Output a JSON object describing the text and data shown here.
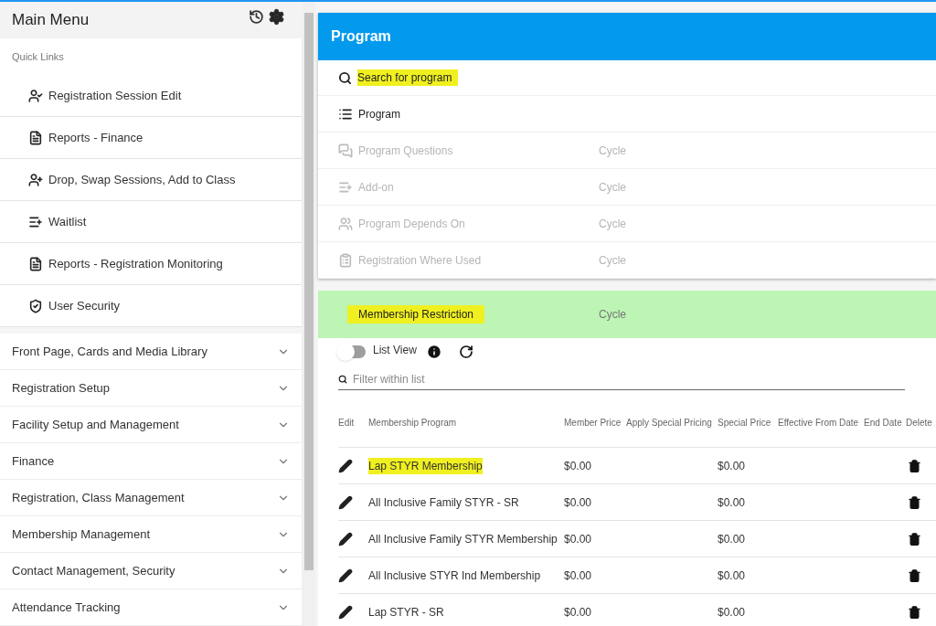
{
  "sidebar": {
    "title": "Main Menu",
    "quick_links_label": "Quick Links",
    "quick_links": [
      {
        "label": "Registration Session Edit"
      },
      {
        "label": "Reports - Finance"
      },
      {
        "label": "Drop, Swap Sessions, Add to Class"
      },
      {
        "label": "Waitlist"
      },
      {
        "label": "Reports - Registration Monitoring"
      },
      {
        "label": "User Security"
      }
    ],
    "sections": [
      {
        "label": "Front Page, Cards and Media Library",
        "expanded": false
      },
      {
        "label": "Registration Setup",
        "expanded": false
      },
      {
        "label": "Facility Setup and Management",
        "expanded": false
      },
      {
        "label": "Finance",
        "expanded": false
      },
      {
        "label": "Registration, Class Management",
        "expanded": false
      },
      {
        "label": "Membership Management",
        "expanded": false
      },
      {
        "label": "Contact Management, Security",
        "expanded": false
      },
      {
        "label": "Attendance Tracking",
        "expanded": false
      }
    ]
  },
  "program": {
    "title": "Program",
    "search": {
      "placeholder": "Search for program",
      "highlighted": true
    },
    "items": [
      {
        "label": "Program",
        "disabled": false
      },
      {
        "label": "Program Questions",
        "disabled": true,
        "note": "Cycle"
      },
      {
        "label": "Add-on",
        "disabled": true,
        "note": "Cycle"
      },
      {
        "label": "Program Depends On",
        "disabled": true,
        "note": "Cycle"
      },
      {
        "label": "Registration Where Used",
        "disabled": true,
        "note": "Cycle"
      }
    ]
  },
  "restriction": {
    "label": "Membership Restriction",
    "note": "Cycle",
    "selected": true,
    "highlighted": true,
    "list_view": {
      "label": "List View",
      "on": false
    },
    "filter": {
      "placeholder": "Filter within list"
    },
    "columns": [
      "Edit",
      "Membership Program",
      "Member Price",
      "Apply Special Pricing",
      "Special Price",
      "Effective From Date",
      "End Date",
      "Delete"
    ],
    "rows": [
      {
        "program": "Lap STYR Membership",
        "member_price": "$0.00",
        "special_price": "$0.00",
        "highlighted": true
      },
      {
        "program": "All Inclusive Family STYR - SR",
        "member_price": "$0.00",
        "special_price": "$0.00",
        "highlighted": false
      },
      {
        "program": "All Inclusive Family STYR Membership",
        "member_price": "$0.00",
        "special_price": "$0.00",
        "highlighted": false
      },
      {
        "program": "All Inclusive STYR Ind Membership",
        "member_price": "$0.00",
        "special_price": "$0.00",
        "highlighted": false
      },
      {
        "program": "Lap STYR - SR",
        "member_price": "$0.00",
        "special_price": "$0.00",
        "highlighted": false
      }
    ]
  }
}
